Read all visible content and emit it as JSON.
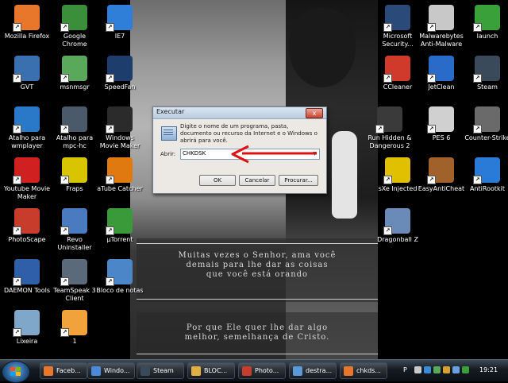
{
  "desktop_icons": [
    {
      "label": "Mozilla Firefox",
      "icon": "firefox-icon",
      "color": "#e8762b"
    },
    {
      "label": "Google Chrome",
      "icon": "chrome-icon",
      "color": "#3b8f3b"
    },
    {
      "label": "IE7",
      "icon": "ie-icon",
      "color": "#2f7ed8"
    },
    {
      "label": "GVT",
      "icon": "network-icon",
      "color": "#3a6fb0"
    },
    {
      "label": "msnmsgr",
      "icon": "msn-icon",
      "color": "#5aa85a"
    },
    {
      "label": "SpeedFan",
      "icon": "speedfan-icon",
      "color": "#1d3d6d"
    },
    {
      "label": "Atalho para wmplayer",
      "icon": "wmplayer-icon",
      "color": "#2a78c8"
    },
    {
      "label": "Atalho para mpc-hc",
      "icon": "mpc-icon",
      "color": "#4a5a6a"
    },
    {
      "label": "Windows Movie Maker",
      "icon": "moviemaker-icon",
      "color": "#2b2b2b"
    },
    {
      "label": "Youtube Movie Maker",
      "icon": "youtube-icon",
      "color": "#d02020"
    },
    {
      "label": "Fraps",
      "icon": "fraps-icon",
      "color": "#d8c400"
    },
    {
      "label": "aTube Catcher",
      "icon": "atube-icon",
      "color": "#e07a10"
    },
    {
      "label": "PhotoScape",
      "icon": "photoscape-icon",
      "color": "#c83c2c"
    },
    {
      "label": "Revo Uninstaller",
      "icon": "revo-icon",
      "color": "#4a7abf"
    },
    {
      "label": "µTorrent",
      "icon": "utorrent-icon",
      "color": "#3a9a3a"
    },
    {
      "label": "DAEMON Tools",
      "icon": "daemon-icon",
      "color": "#2e5fa8"
    },
    {
      "label": "TeamSpeak 3 Client",
      "icon": "teamspeak-icon",
      "color": "#5a6a7a"
    },
    {
      "label": "Bloco de notas",
      "icon": "notepad-icon",
      "color": "#4a86c8"
    },
    {
      "label": "Lixeira",
      "icon": "recycle-bin-icon",
      "color": "#7fa7c9"
    },
    {
      "label": "1",
      "icon": "document-icon",
      "color": "#f2a23a"
    },
    {
      "label": "Microsoft Security...",
      "icon": "security-icon",
      "color": "#2a4a7a"
    },
    {
      "label": "Malwarebytes Anti-Malware",
      "icon": "malwarebytes-icon",
      "color": "#c8c8c8"
    },
    {
      "label": "launch",
      "icon": "launch-icon",
      "color": "#3aa03a"
    },
    {
      "label": "CCleaner",
      "icon": "ccleaner-icon",
      "color": "#d03a2a"
    },
    {
      "label": "JetClean",
      "icon": "jetclean-icon",
      "color": "#2a6ac8"
    },
    {
      "label": "Steam",
      "icon": "steam-icon",
      "color": "#3a4a5a"
    },
    {
      "label": "Run Hidden & Dangerous 2",
      "icon": "hd2-icon",
      "color": "#3a3a3a"
    },
    {
      "label": "PES 6",
      "icon": "pes-icon",
      "color": "#d0d0d0"
    },
    {
      "label": "Counter-Strike",
      "icon": "counterstrike-icon",
      "color": "#6a6a6a"
    },
    {
      "label": "sXe Injected",
      "icon": "sxe-icon",
      "color": "#e0c000"
    },
    {
      "label": "EasyAntiCheat",
      "icon": "easyanticheat-icon",
      "color": "#a0622a"
    },
    {
      "label": "AntiRootkit",
      "icon": "antirootkit-icon",
      "color": "#2a7ad8"
    },
    {
      "label": "Dragonball Z",
      "icon": "app-window-icon",
      "color": "#6a8ab8"
    }
  ],
  "wallpaper": {
    "text_top": [
      "Muitas vezes o Senhor, ama você",
      "demais para lhe dar as coisas",
      "que você está orando"
    ],
    "text_bottom": [
      "Por que Ele quer lhe dar algo",
      "melhor, semelhança de Cristo."
    ]
  },
  "run_dialog": {
    "title": "Executar",
    "close_label": "x",
    "description": "Digite o nome de um programa, pasta, documento ou recurso da Internet e o Windows o abrirá para você.",
    "open_label": "Abrir:",
    "input_value": "CHKDSK",
    "ok_label": "OK",
    "cancel_label": "Cancelar",
    "browse_label": "Procurar..."
  },
  "annotation_color": "#e01010",
  "taskbar": {
    "tasks": [
      {
        "label": "Faceb...",
        "icon": "firefox-icon",
        "color": "#e8762b"
      },
      {
        "label": "Windo...",
        "icon": "windows-explorer-icon",
        "color": "#4a8ad8"
      },
      {
        "label": "Steam",
        "icon": "steam-icon",
        "color": "#3a4a5a"
      },
      {
        "label": "BLOC...",
        "icon": "folder-icon",
        "color": "#e0b040"
      },
      {
        "label": "Photo...",
        "icon": "photoscape-icon",
        "color": "#c83c2c"
      },
      {
        "label": "destra...",
        "icon": "paint-icon",
        "color": "#5a9ad8"
      },
      {
        "label": "chkds...",
        "icon": "firefox-icon",
        "color": "#e8762b"
      }
    ],
    "tray_lang": "P",
    "clock": "19:21"
  }
}
